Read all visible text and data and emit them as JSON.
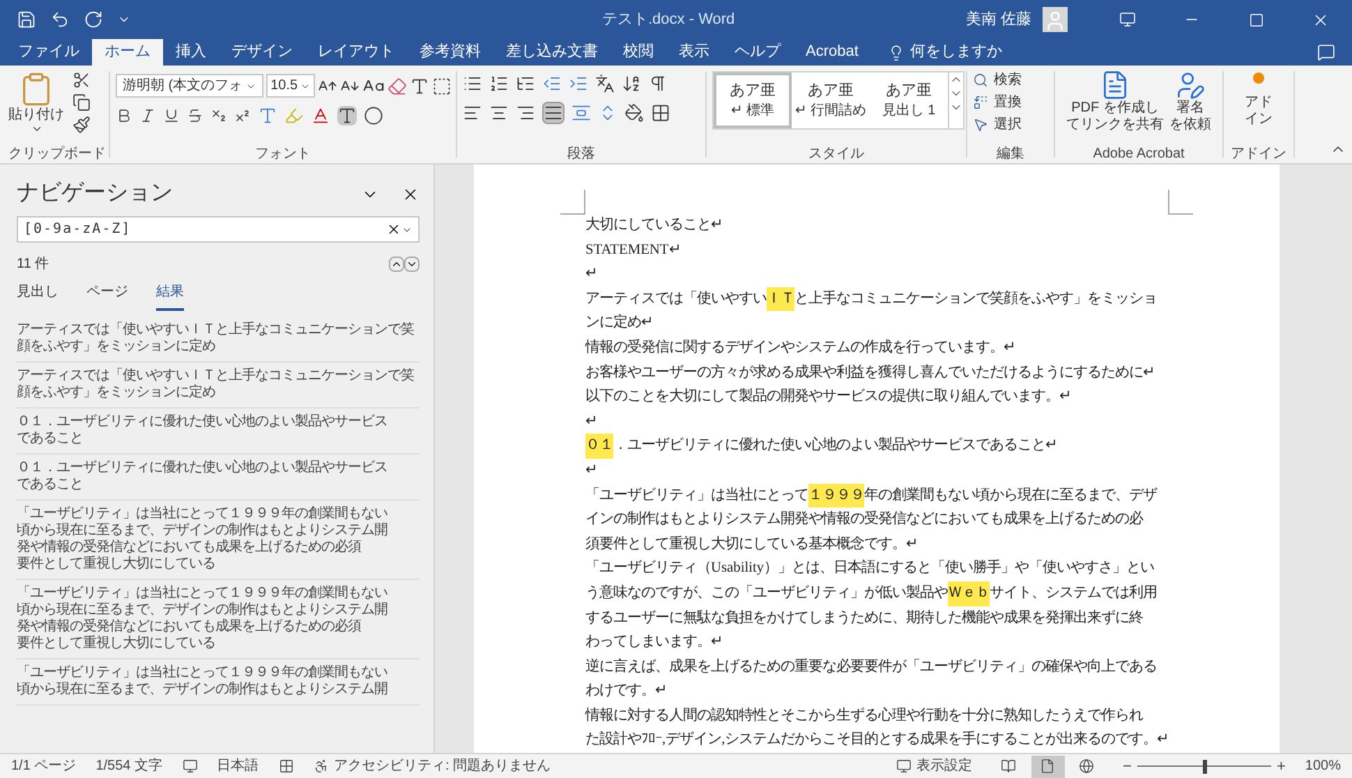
{
  "window": {
    "title": "テスト.docx - Word",
    "user": "美南 佐藤"
  },
  "ribbon_tabs": [
    {
      "label": "ファイル",
      "selected": false
    },
    {
      "label": "ホーム",
      "selected": true
    },
    {
      "label": "挿入",
      "selected": false
    },
    {
      "label": "デザイン",
      "selected": false
    },
    {
      "label": "レイアウト",
      "selected": false
    },
    {
      "label": "参考資料",
      "selected": false
    },
    {
      "label": "差し込み文書",
      "selected": false
    },
    {
      "label": "校閲",
      "selected": false
    },
    {
      "label": "表示",
      "selected": false
    },
    {
      "label": "ヘルプ",
      "selected": false
    },
    {
      "label": "Acrobat",
      "selected": false
    }
  ],
  "tell_me": "何をしますか",
  "ribbon": {
    "clipboard": {
      "label": "クリップボード",
      "paste": "貼り付け"
    },
    "font": {
      "label": "フォント",
      "font_name": "游明朝 (本文のフォ",
      "font_size": "10.5"
    },
    "paragraph": {
      "label": "段落"
    },
    "styles": {
      "label": "スタイル",
      "items": [
        {
          "sample": "あア亜",
          "name": "↵ 標準",
          "selected": true
        },
        {
          "sample": "あア亜",
          "name": "↵ 行間詰め",
          "selected": false
        },
        {
          "sample": "あア亜",
          "name": "見出し 1",
          "selected": false
        }
      ]
    },
    "editing": {
      "label": "編集",
      "items": [
        "検索",
        "置換",
        "選択"
      ]
    },
    "acrobat": {
      "label": "Adobe Acrobat",
      "items": [
        [
          "PDF を作成し",
          "てリンクを共有"
        ],
        [
          "署名",
          "を依頼"
        ]
      ]
    },
    "addin": {
      "label": "アドイン",
      "button": [
        "アド",
        "イン"
      ]
    }
  },
  "navigation": {
    "title": "ナビゲーション",
    "search_value": "[0-9a-zA-Z]",
    "count": "11 件",
    "tabs": [
      {
        "label": "見出し",
        "selected": false
      },
      {
        "label": "ページ",
        "selected": false
      },
      {
        "label": "結果",
        "selected": true
      }
    ],
    "results": [
      [
        "アーティスでは「使いやすいＩＴと上手なコミュニケーションで笑",
        "顔をふやす」をミッションに定め"
      ],
      [
        "アーティスでは「使いやすいＩＴと上手なコミュニケーションで笑",
        "顔をふやす」をミッションに定め"
      ],
      [
        "０１．ユーザビリティに優れた使い心地のよい製品やサービス",
        "であること"
      ],
      [
        "０１．ユーザビリティに優れた使い心地のよい製品やサービス",
        "であること"
      ],
      [
        "「ユーザビリティ」は当社にとって１９９９年の創業間もない",
        "頃から現在に至るまで、デザインの制作はもとよりシステム開",
        "発や情報の受発信などにおいても成果を上げるための必須",
        "要件として重視し大切にしている"
      ],
      [
        "「ユーザビリティ」は当社にとって１９９９年の創業間もない",
        "頃から現在に至るまで、デザインの制作はもとよりシステム開",
        "発や情報の受発信などにおいても成果を上げるための必須",
        "要件として重視し大切にしている"
      ],
      [
        "「ユーザビリティ」は当社にとって１９９９年の創業間もない",
        "頃から現在に至るまで、デザインの制作はもとよりシステム開"
      ]
    ]
  },
  "document": {
    "lines": [
      [
        {
          "text": "大切にしていること↵",
          "highlighted": false
        }
      ],
      [
        {
          "text": "STATEMENT↵",
          "highlighted": false
        }
      ],
      [
        {
          "text": "↵",
          "highlighted": false
        }
      ],
      [
        {
          "text": "アーティスでは「使いやすい",
          "highlighted": false
        },
        {
          "text": "ＩＴ",
          "highlighted": true
        },
        {
          "text": "と上手なコミュニケーションで笑顔をふやす」をミッショ",
          "highlighted": false
        }
      ],
      [
        {
          "text": "ンに定め↵",
          "highlighted": false
        }
      ],
      [
        {
          "text": "情報の受発信に関するデザインやシステムの作成を行っています。↵",
          "highlighted": false
        }
      ],
      [
        {
          "text": "お客様やユーザーの方々が求める成果や利益を獲得し喜んでいただけるようにするために↵",
          "highlighted": false
        }
      ],
      [
        {
          "text": "以下のことを大切にして製品の開発やサービスの提供に取り組んでいます。↵",
          "highlighted": false
        }
      ],
      [
        {
          "text": "↵",
          "highlighted": false
        }
      ],
      [
        {
          "text": "０１",
          "highlighted": true
        },
        {
          "text": "．ユーザビリティに優れた使い心地のよい製品やサービスであること↵",
          "highlighted": false
        }
      ],
      [
        {
          "text": "↵",
          "highlighted": false
        }
      ],
      [
        {
          "text": "「ユーザビリティ」は当社にとって",
          "highlighted": false
        },
        {
          "text": "１９９９",
          "highlighted": true
        },
        {
          "text": "年の創業間もない頃から現在に至るまで、デザ",
          "highlighted": false
        }
      ],
      [
        {
          "text": "インの制作はもとよりシステム開発や情報の受発信などにおいても成果を上げるための必",
          "highlighted": false
        }
      ],
      [
        {
          "text": "須要件として重視し大切にしている基本概念です。↵",
          "highlighted": false
        }
      ],
      [
        {
          "text": "「ユーザビリティ（Usability）」とは、日本語にすると「使い勝手」や「使いやすさ」とい",
          "highlighted": false
        }
      ],
      [
        {
          "text": "う意味なのですが、この「ユーザビリティ」が低い製品や",
          "highlighted": false
        },
        {
          "text": "Ｗｅｂ",
          "highlighted": true
        },
        {
          "text": "サイト、システムでは利用",
          "highlighted": false
        }
      ],
      [
        {
          "text": "するユーザーに無駄な負担をかけてしまうために、期待した機能や成果を発揮出来ずに終",
          "highlighted": false
        }
      ],
      [
        {
          "text": "わってしまいます。↵",
          "highlighted": false
        }
      ],
      [
        {
          "text": "逆に言えば、成果を上げるための重要な必要要件が「ユーザビリティ」の確保や向上である",
          "highlighted": false
        }
      ],
      [
        {
          "text": "わけです。↵",
          "highlighted": false
        }
      ],
      [
        {
          "text": "情報に対する人間の認知特性とそこから生ずる心理や行動を十分に熟知したうえで作られ",
          "highlighted": false
        }
      ],
      [
        {
          "text": "た設計やﾌﾛｰ,デザイン,システムだからこそ目的とする成果を手にすることが出来るのです。↵",
          "highlighted": false
        }
      ]
    ]
  },
  "status_bar": {
    "page": "1/1 ページ",
    "words": "1/554 文字",
    "language": "日本語",
    "accessibility": "アクセシビリティ: 問題ありません",
    "display_settings": "表示設定",
    "views": [
      {
        "kind": "read",
        "selected": false
      },
      {
        "kind": "print",
        "selected": true
      },
      {
        "kind": "web",
        "selected": false
      }
    ],
    "zoom_out": "−",
    "zoom_slider": {
      "level": 0.5
    },
    "zoom_in": "+",
    "zoom": "100%"
  }
}
